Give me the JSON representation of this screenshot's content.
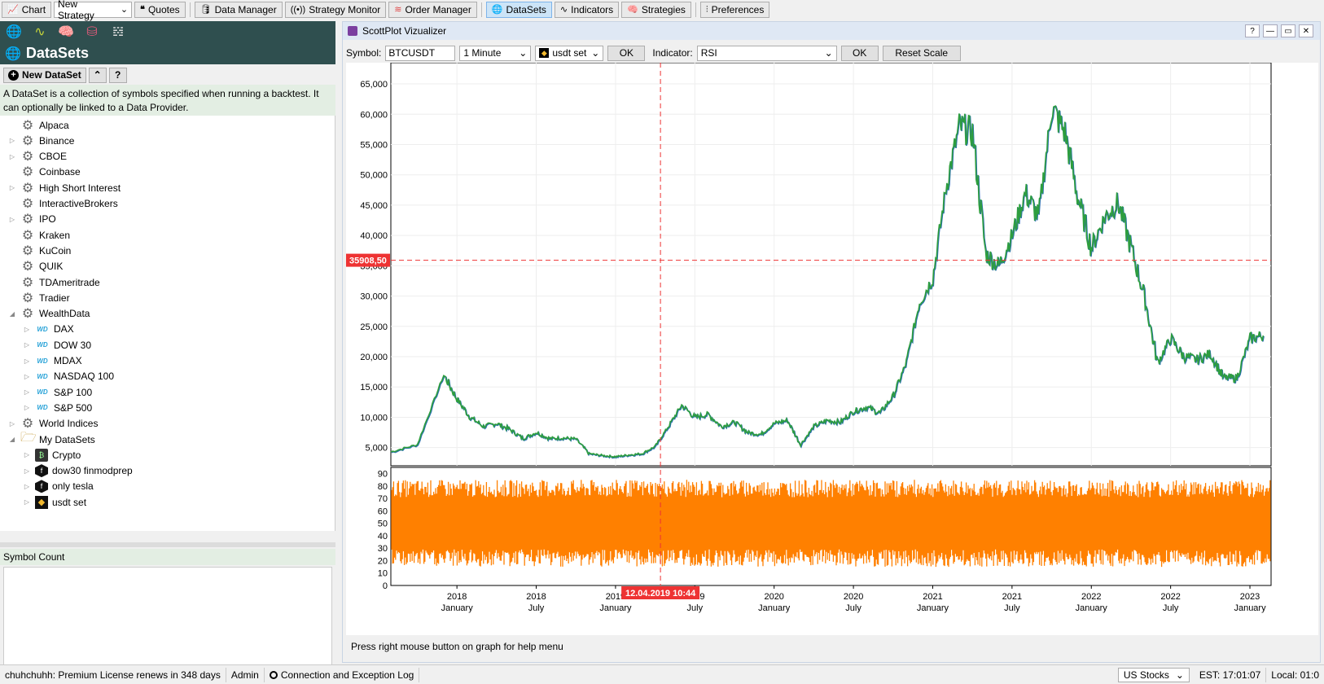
{
  "toolbar": {
    "chart": "Chart",
    "strategy_select": "New Strategy",
    "quotes": "Quotes",
    "data_manager": "Data Manager",
    "strategy_monitor": "Strategy Monitor",
    "order_manager": "Order Manager",
    "datasets": "DataSets",
    "indicators": "Indicators",
    "strategies": "Strategies",
    "preferences": "Preferences"
  },
  "left": {
    "title": "DataSets",
    "new_dataset": "New DataSet",
    "help": "?",
    "description": "A DataSet is a collection of symbols specified when running a backtest. It can optionally be linked to a Data Provider.",
    "tree": [
      {
        "label": "Alpaca",
        "level": 0,
        "icon": "gear-icon",
        "expander": ""
      },
      {
        "label": "Binance",
        "level": 0,
        "icon": "gear-icon",
        "expander": "▷"
      },
      {
        "label": "CBOE",
        "level": 0,
        "icon": "gear-icon",
        "expander": "▷"
      },
      {
        "label": "Coinbase",
        "level": 0,
        "icon": "gear-icon",
        "expander": ""
      },
      {
        "label": "High Short Interest",
        "level": 0,
        "icon": "gear-icon",
        "expander": "▷"
      },
      {
        "label": "InteractiveBrokers",
        "level": 0,
        "icon": "gear-icon",
        "expander": ""
      },
      {
        "label": "IPO",
        "level": 0,
        "icon": "gear-icon",
        "expander": "▷"
      },
      {
        "label": "Kraken",
        "level": 0,
        "icon": "gear-icon",
        "expander": ""
      },
      {
        "label": "KuCoin",
        "level": 0,
        "icon": "gear-icon",
        "expander": ""
      },
      {
        "label": "QUIK",
        "level": 0,
        "icon": "gear-icon",
        "expander": ""
      },
      {
        "label": "TDAmeritrade",
        "level": 0,
        "icon": "gear-icon",
        "expander": ""
      },
      {
        "label": "Tradier",
        "level": 0,
        "icon": "gear-icon",
        "expander": ""
      },
      {
        "label": "WealthData",
        "level": 0,
        "icon": "gear-icon",
        "expander": "◢"
      },
      {
        "label": "DAX",
        "level": 1,
        "icon": "wd-icon",
        "expander": "▷"
      },
      {
        "label": "DOW 30",
        "level": 1,
        "icon": "wd-icon",
        "expander": "▷"
      },
      {
        "label": "MDAX",
        "level": 1,
        "icon": "wd-icon",
        "expander": "▷"
      },
      {
        "label": "NASDAQ 100",
        "level": 1,
        "icon": "wd-icon",
        "expander": "▷"
      },
      {
        "label": "S&P 100",
        "level": 1,
        "icon": "wd-icon",
        "expander": "▷"
      },
      {
        "label": "S&P 500",
        "level": 1,
        "icon": "wd-icon",
        "expander": "▷"
      },
      {
        "label": "World Indices",
        "level": 0,
        "icon": "gear-icon",
        "expander": "▷"
      },
      {
        "label": "My DataSets",
        "level": 0,
        "icon": "folder-icon",
        "expander": "◢"
      },
      {
        "label": "Crypto",
        "level": 1,
        "icon": "crypto-icon",
        "expander": "▷"
      },
      {
        "label": "dow30 finmodprep",
        "level": 1,
        "icon": "hex-icon",
        "expander": "▷"
      },
      {
        "label": "only tesla",
        "level": 1,
        "icon": "hex-icon",
        "expander": "▷"
      },
      {
        "label": "usdt set",
        "level": 1,
        "icon": "binance-icon",
        "expander": "▷"
      }
    ],
    "symbol_count": "Symbol Count"
  },
  "window": {
    "title": "ScottPlot Vizualizer",
    "symbol_label": "Symbol:",
    "symbol_value": "BTCUSDT",
    "interval": "1 Minute",
    "dataset": "usdt set",
    "ok1": "OK",
    "indicator_label": "Indicator:",
    "indicator_value": "RSI",
    "ok2": "OK",
    "reset_scale": "Reset Scale",
    "help_text": "Press right mouse button on graph for help menu"
  },
  "chart_data": {
    "type": "line",
    "crosshair_price": "35908,50",
    "crosshair_date": "12.04.2019 10:44",
    "price_yticks": [
      "5,000",
      "10,000",
      "15,000",
      "20,000",
      "25,000",
      "30,000",
      "35,000",
      "40,000",
      "45,000",
      "50,000",
      "55,000",
      "60,000",
      "65,000"
    ],
    "rsi_yticks": [
      "0",
      "10",
      "20",
      "30",
      "40",
      "50",
      "60",
      "70",
      "80",
      "90"
    ],
    "xticks": [
      {
        "year": "2018",
        "month": "January"
      },
      {
        "year": "2018",
        "month": "July"
      },
      {
        "year": "2019",
        "month": "January"
      },
      {
        "year": "2019",
        "month": "July"
      },
      {
        "year": "2020",
        "month": "January"
      },
      {
        "year": "2020",
        "month": "July"
      },
      {
        "year": "2021",
        "month": "January"
      },
      {
        "year": "2021",
        "month": "July"
      },
      {
        "year": "2022",
        "month": "January"
      },
      {
        "year": "2022",
        "month": "July"
      },
      {
        "year": "2023",
        "month": "January"
      }
    ],
    "price_series": {
      "name": "BTCUSDT",
      "color": "#2e9e3e",
      "points": [
        [
          "2017-08",
          4300
        ],
        [
          "2017-10",
          5500
        ],
        [
          "2017-12",
          17000
        ],
        [
          "2018-01",
          13000
        ],
        [
          "2018-02",
          10000
        ],
        [
          "2018-03",
          8500
        ],
        [
          "2018-04",
          9000
        ],
        [
          "2018-05",
          8000
        ],
        [
          "2018-06",
          6500
        ],
        [
          "2018-07",
          7500
        ],
        [
          "2018-08",
          6500
        ],
        [
          "2018-09",
          6600
        ],
        [
          "2018-10",
          6400
        ],
        [
          "2018-11",
          4000
        ],
        [
          "2018-12",
          3700
        ],
        [
          "2019-01",
          3500
        ],
        [
          "2019-02",
          3800
        ],
        [
          "2019-03",
          4000
        ],
        [
          "2019-04",
          5200
        ],
        [
          "2019-05",
          8500
        ],
        [
          "2019-06",
          12000
        ],
        [
          "2019-07",
          10000
        ],
        [
          "2019-08",
          10500
        ],
        [
          "2019-09",
          8500
        ],
        [
          "2019-10",
          9200
        ],
        [
          "2019-11",
          7500
        ],
        [
          "2019-12",
          7200
        ],
        [
          "2020-01",
          9000
        ],
        [
          "2020-02",
          9500
        ],
        [
          "2020-03",
          5500
        ],
        [
          "2020-04",
          8500
        ],
        [
          "2020-05",
          9500
        ],
        [
          "2020-06",
          9200
        ],
        [
          "2020-07",
          11000
        ],
        [
          "2020-08",
          11700
        ],
        [
          "2020-09",
          10700
        ],
        [
          "2020-10",
          13500
        ],
        [
          "2020-11",
          19000
        ],
        [
          "2020-12",
          29000
        ],
        [
          "2021-01",
          33000
        ],
        [
          "2021-02",
          48000
        ],
        [
          "2021-03",
          58000
        ],
        [
          "2021-04",
          57000
        ],
        [
          "2021-05",
          37000
        ],
        [
          "2021-06",
          35000
        ],
        [
          "2021-07",
          40000
        ],
        [
          "2021-08",
          47000
        ],
        [
          "2021-09",
          43000
        ],
        [
          "2021-10",
          61000
        ],
        [
          "2021-11",
          57000
        ],
        [
          "2021-12",
          46000
        ],
        [
          "2022-01",
          38000
        ],
        [
          "2022-02",
          43000
        ],
        [
          "2022-03",
          45500
        ],
        [
          "2022-04",
          38000
        ],
        [
          "2022-05",
          30000
        ],
        [
          "2022-06",
          19000
        ],
        [
          "2022-07",
          23000
        ],
        [
          "2022-08",
          20000
        ],
        [
          "2022-09",
          19500
        ],
        [
          "2022-10",
          20500
        ],
        [
          "2022-11",
          16500
        ],
        [
          "2022-12",
          16500
        ],
        [
          "2023-01",
          23000
        ],
        [
          "2023-02",
          23500
        ]
      ]
    },
    "rsi_series": {
      "name": "RSI",
      "color": "#ff8000",
      "mid": 50,
      "amplitude": 35
    }
  },
  "bottom": {
    "license": "chuhchuhh: Premium License renews in 348 days",
    "admin": "Admin",
    "connection": "Connection and Exception Log",
    "market": "US Stocks",
    "est": "EST: 17:01:07",
    "local": "Local: 01:0"
  }
}
